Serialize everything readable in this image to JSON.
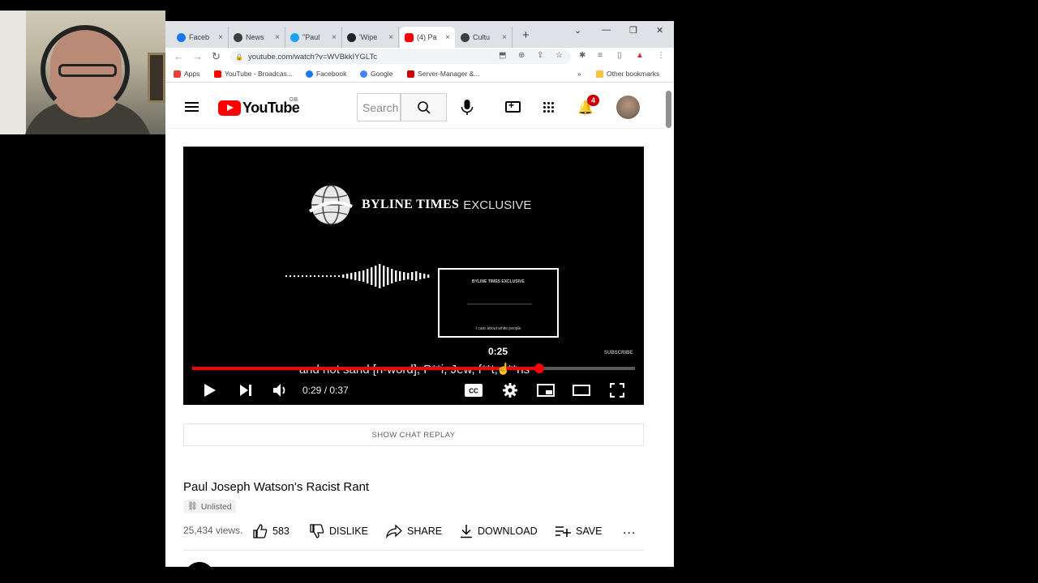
{
  "browser": {
    "tabs": [
      {
        "label": "Faceb",
        "icon": "facebook-icon",
        "color": "#1877f2",
        "active": false
      },
      {
        "label": "News",
        "icon": "globe-icon",
        "color": "#3c4043",
        "active": false
      },
      {
        "label": "\"Paul",
        "icon": "twitter-icon",
        "color": "#1da1f2",
        "active": false
      },
      {
        "label": "'Wipe",
        "icon": "site-icon",
        "color": "#202124",
        "active": false
      },
      {
        "label": "(4) Pa",
        "icon": "youtube-icon",
        "color": "#ff0000",
        "active": true
      },
      {
        "label": "Cultu",
        "icon": "globe-icon",
        "color": "#3c4043",
        "active": false
      }
    ],
    "new_tab": "+",
    "close_glyph": "×",
    "url": "youtube.com/watch?v=WVBkkIYGLTc",
    "bookmarks": [
      {
        "label": "Apps",
        "color": "#ea4335"
      },
      {
        "label": "YouTube - Broadcas...",
        "color": "#ff0000"
      },
      {
        "label": "Facebook",
        "color": "#1877f2"
      },
      {
        "label": "Google",
        "color": "#4285f4"
      },
      {
        "label": "Server-Manager &...",
        "color": "#cc0000"
      }
    ],
    "bookmarks_overflow": "»",
    "other_bookmarks": "Other bookmarks"
  },
  "youtube": {
    "logo_text": "YouTube",
    "region": "GB",
    "search_placeholder": "Search",
    "notification_count": "4"
  },
  "video": {
    "brand_title": "BYLINE TIMES",
    "brand_suffix": "EXCLUSIVE",
    "preview_title": "BYLINE TIMES EXCLUSIVE",
    "preview_caption": "I care about white people",
    "preview_time": "0:25",
    "subscribe_mark": "SUBSCRIBE",
    "caption": "and not sand [n-word], P**i, Jew, f**t, c**ns",
    "current_time": "0:29",
    "duration": "0:37",
    "time_display": "0:29 / 0:37",
    "progress": 0.784
  },
  "chat_replay": "SHOW CHAT REPLAY",
  "title": "Paul Joseph Watson's Racist Rant",
  "privacy": "Unlisted",
  "views": "25,434 views.",
  "actions": {
    "like": "583",
    "dislike": "DISLIKE",
    "share": "SHARE",
    "download": "DOWNLOAD",
    "save": "SAVE",
    "more": "..."
  }
}
